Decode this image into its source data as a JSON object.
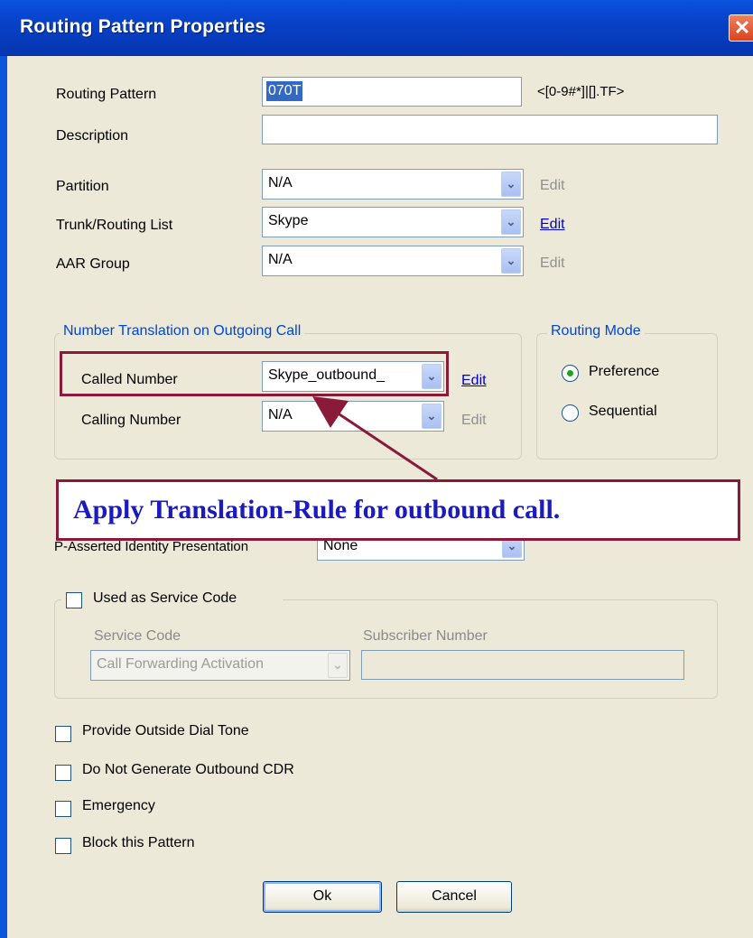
{
  "window": {
    "title": "Routing Pattern Properties",
    "close_glyph": "✕"
  },
  "fields": {
    "routing_pattern_label": "Routing Pattern",
    "routing_pattern_value": "070T",
    "routing_pattern_hint": "<[0-9#*]|[].TF>",
    "description_label": "Description",
    "description_value": "",
    "partition_label": "Partition",
    "partition_value": "N/A",
    "trunk_label": "Trunk/Routing List",
    "trunk_value": "Skype",
    "aar_label": "AAR Group",
    "aar_value": "N/A",
    "edit_label": "Edit"
  },
  "number_translation": {
    "legend": "Number Translation on Outgoing Call",
    "called_label": "Called Number",
    "called_value": "Skype_outbound_",
    "calling_label": "Calling Number",
    "calling_value": "N/A"
  },
  "routing_mode": {
    "legend": "Routing Mode",
    "options": [
      {
        "label": "Preference",
        "checked": true
      },
      {
        "label": "Sequential",
        "checked": false
      }
    ]
  },
  "annotation": {
    "text": "Apply Translation-Rule  for outbound call.",
    "color": "#8b1a3a"
  },
  "p_asserted": {
    "label": "P-Asserted Identity Presentation",
    "value": "None"
  },
  "service_code": {
    "checkbox_label": "Used as Service Code",
    "code_label": "Service Code",
    "code_value": "Call Forwarding Activation",
    "subscriber_label": "Subscriber Number",
    "subscriber_value": ""
  },
  "options": [
    {
      "label": "Provide Outside Dial Tone",
      "checked": false
    },
    {
      "label": "Do Not Generate Outbound CDR",
      "checked": false
    },
    {
      "label": "Emergency",
      "checked": false
    },
    {
      "label": "Block this Pattern",
      "checked": false
    }
  ],
  "buttons": {
    "ok": "Ok",
    "cancel": "Cancel"
  },
  "icons": {
    "dropdown": "chevron-down-icon"
  }
}
